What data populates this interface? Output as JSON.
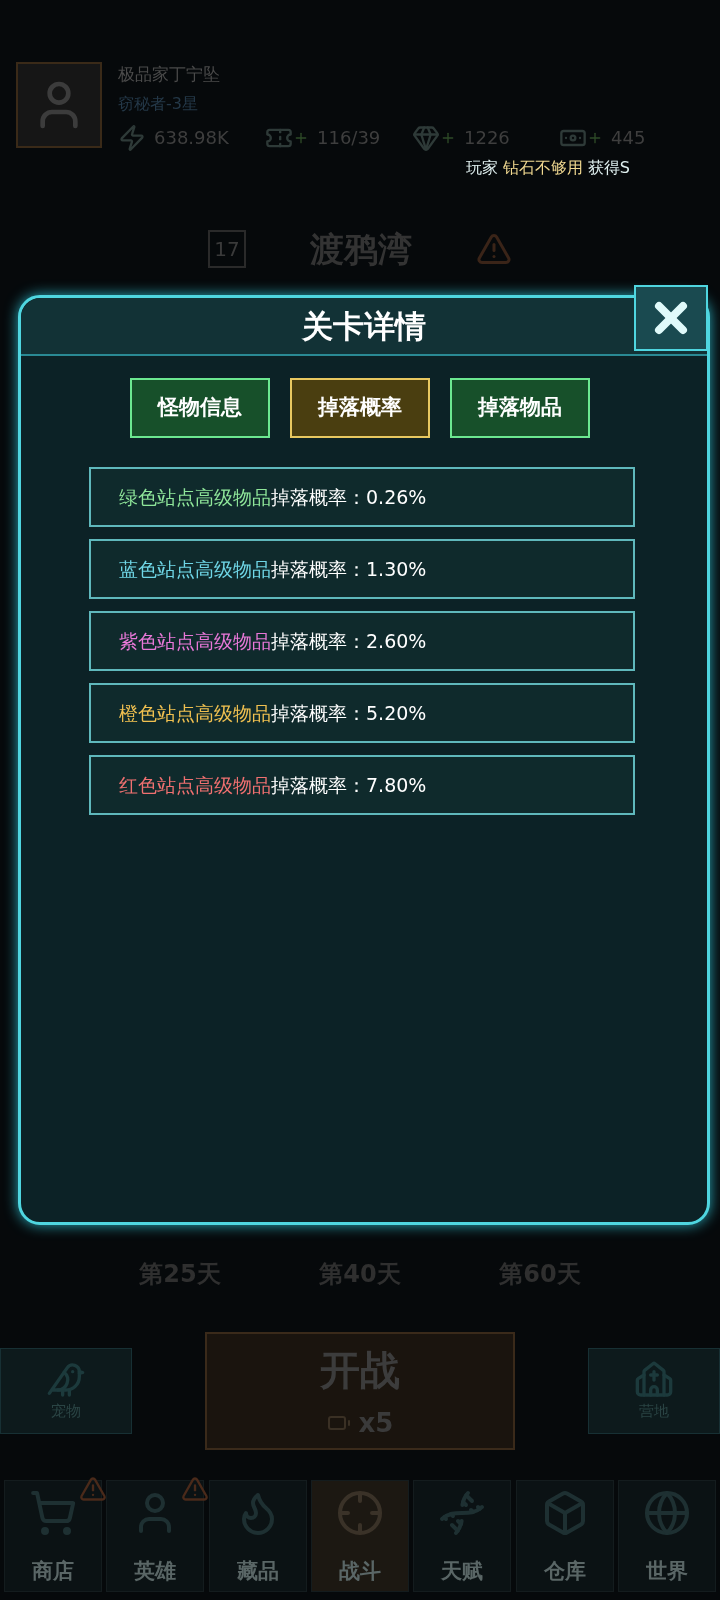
{
  "player": {
    "name": "极品家丁宁坠",
    "rank": "窃秘者-3星"
  },
  "resources": [
    {
      "kind": "power",
      "value": "638.98K"
    },
    {
      "kind": "ticket",
      "value": "116/39"
    },
    {
      "kind": "diamond",
      "value": "1226"
    },
    {
      "kind": "cash",
      "value": "445"
    }
  ],
  "ticker": {
    "prefix": "玩家",
    "player": "钻石不够用",
    "message": "获得S"
  },
  "stage": {
    "number": "17",
    "name": "渡鸦湾"
  },
  "days": [
    "第25天",
    "第40天",
    "第60天"
  ],
  "side_buttons": [
    {
      "kind": "pet",
      "label": "宠物"
    },
    {
      "kind": "camp",
      "label": "营地"
    }
  ],
  "battle_button": {
    "label": "开战",
    "cost": "x5"
  },
  "nav": [
    {
      "kind": "shop",
      "label": "商店",
      "alert": true,
      "selected": false
    },
    {
      "kind": "hero",
      "label": "英雄",
      "alert": true,
      "selected": false
    },
    {
      "kind": "collection",
      "label": "藏品",
      "alert": false,
      "selected": false
    },
    {
      "kind": "battle",
      "label": "战斗",
      "alert": false,
      "selected": true
    },
    {
      "kind": "talent",
      "label": "天赋",
      "alert": false,
      "selected": false
    },
    {
      "kind": "storage",
      "label": "仓库",
      "alert": false,
      "selected": false
    },
    {
      "kind": "world",
      "label": "世界",
      "alert": false,
      "selected": false
    }
  ],
  "dialog": {
    "title": "关卡详情",
    "tabs": [
      {
        "label": "怪物信息",
        "selected": false
      },
      {
        "label": "掉落概率",
        "selected": true
      },
      {
        "label": "掉落物品",
        "selected": false
      }
    ],
    "rows": [
      {
        "item": "绿色站点高级物品",
        "color": "#8fe69a",
        "text": "掉落概率：0.26%"
      },
      {
        "item": "蓝色站点高级物品",
        "color": "#6fd6e6",
        "text": "掉落概率：1.30%"
      },
      {
        "item": "紫色站点高级物品",
        "color": "#e878d8",
        "text": "掉落概率：2.60%"
      },
      {
        "item": "橙色站点高级物品",
        "color": "#f0c050",
        "text": "掉落概率：5.20%"
      },
      {
        "item": "红色站点高级物品",
        "color": "#f07070",
        "text": "掉落概率：7.80%"
      }
    ]
  }
}
